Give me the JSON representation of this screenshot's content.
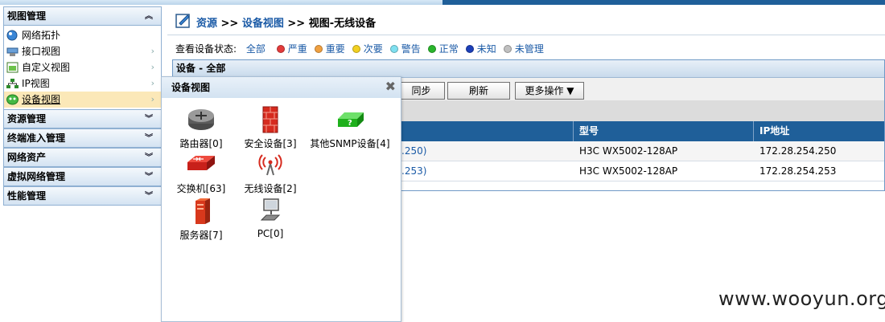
{
  "sidebar": {
    "sections": [
      {
        "title": "视图管理",
        "expanded": true,
        "chevron": "⌃"
      },
      {
        "title": "资源管理",
        "expanded": false
      },
      {
        "title": "终端准入管理",
        "expanded": false
      },
      {
        "title": "网络资产",
        "expanded": false
      },
      {
        "title": "虚拟网络管理",
        "expanded": false
      },
      {
        "title": "性能管理",
        "expanded": false
      }
    ],
    "items": [
      {
        "label": "网络拓扑",
        "icon": "network-topology-icon"
      },
      {
        "label": "接口视图",
        "icon": "interface-view-icon"
      },
      {
        "label": "自定义视图",
        "icon": "custom-view-icon"
      },
      {
        "label": "IP视图",
        "icon": "ip-view-icon"
      },
      {
        "label": "设备视图",
        "icon": "device-view-icon",
        "selected": true
      }
    ]
  },
  "breadcrumb": {
    "part1": "资源",
    "sep1": " >> ",
    "part2": "设备视图",
    "sep2": " >> ",
    "part3": "视图-无线设备"
  },
  "status_filter": {
    "label": "查看设备状态:",
    "all": "全部",
    "options": [
      {
        "label": "严重",
        "color": "#e33b3b"
      },
      {
        "label": "重要",
        "color": "#f0a040"
      },
      {
        "label": "次要",
        "color": "#f2d020"
      },
      {
        "label": "警告",
        "color": "#7fe0f0"
      },
      {
        "label": "正常",
        "color": "#29b52b"
      },
      {
        "label": "未知",
        "color": "#1c3fb8"
      },
      {
        "label": "未管理",
        "color": "#c0c0c0"
      }
    ]
  },
  "grid": {
    "title": "设备 - 全部",
    "buttons": {
      "sync": "同步",
      "refresh": "刷新",
      "more": "更多操作 ▼"
    },
    "columns": {
      "model": "型号",
      "ip": "IP地址"
    },
    "rows": [
      {
        "name_tail": ".250)",
        "model": "H3C WX5002-128AP",
        "ip": "172.28.254.250"
      },
      {
        "name_tail": ".253)",
        "model": "H3C WX5002-128AP",
        "ip": "172.28.254.253"
      }
    ]
  },
  "popup": {
    "title": "设备视图",
    "close": "✖",
    "categories": [
      {
        "label": "路由器[0]",
        "icon": "router-icon"
      },
      {
        "label": "安全设备[3]",
        "icon": "firewall-icon"
      },
      {
        "label": "其他SNMP设备[4]",
        "icon": "snmp-device-icon"
      },
      {
        "label": "交换机[63]",
        "icon": "switch-icon"
      },
      {
        "label": "无线设备[2]",
        "icon": "wireless-icon"
      },
      {
        "label": "服务器[7]",
        "icon": "server-icon"
      },
      {
        "label": "PC[0]",
        "icon": "pc-icon"
      }
    ]
  },
  "watermark": "www.wooyun.org"
}
